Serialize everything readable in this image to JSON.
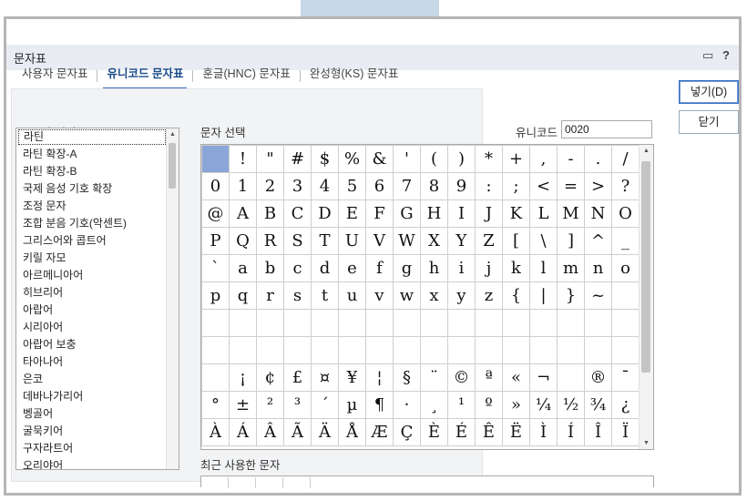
{
  "window": {
    "title": "문자표"
  },
  "tabs": [
    "사용자 문자표",
    "유니코드 문자표",
    "훈글(HNC) 문자표",
    "완성형(KS) 문자표"
  ],
  "active_tab": 1,
  "buttons": {
    "insert": "넣기(D)",
    "close": "닫기"
  },
  "labels": {
    "area": "문자 영역",
    "select": "문자 선택",
    "unicode": "유니코드",
    "recent": "최근 사용한 문자"
  },
  "unicode_value": "0020",
  "areas": [
    "라틴",
    "라틴 확장-A",
    "라틴 확장-B",
    "국제 음성 기호 확장",
    "조정 문자",
    "조합 분음 기호(악센트)",
    "그리스어와 콥트어",
    "키릴 자모",
    "아르메니아어",
    "히브리어",
    "아랍어",
    "시리아어",
    "아랍어 보충",
    "타아나어",
    "은코",
    "데바나가리어",
    "벵골어",
    "굴묵키어",
    "구자라트어",
    "오리야어"
  ],
  "selected_area": 0,
  "chars": [
    [
      " ",
      "!",
      "\"",
      "#",
      "$",
      "%",
      "&",
      "'",
      "(",
      ")",
      "*",
      "+",
      ",",
      "-",
      ".",
      "/"
    ],
    [
      "0",
      "1",
      "2",
      "3",
      "4",
      "5",
      "6",
      "7",
      "8",
      "9",
      ":",
      ";",
      "<",
      "=",
      ">",
      "?"
    ],
    [
      "@",
      "A",
      "B",
      "C",
      "D",
      "E",
      "F",
      "G",
      "H",
      "I",
      "J",
      "K",
      "L",
      "M",
      "N",
      "O"
    ],
    [
      "P",
      "Q",
      "R",
      "S",
      "T",
      "U",
      "V",
      "W",
      "X",
      "Y",
      "Z",
      "[",
      "\\",
      "]",
      "^",
      "_"
    ],
    [
      "`",
      "a",
      "b",
      "c",
      "d",
      "e",
      "f",
      "g",
      "h",
      "i",
      "j",
      "k",
      "l",
      "m",
      "n",
      "o"
    ],
    [
      "p",
      "q",
      "r",
      "s",
      "t",
      "u",
      "v",
      "w",
      "x",
      "y",
      "z",
      "{",
      "|",
      "}",
      "~",
      ""
    ],
    [
      "",
      "",
      "",
      "",
      "",
      "",
      "",
      "",
      "",
      "",
      "",
      "",
      "",
      "",
      "",
      ""
    ],
    [
      "",
      "",
      "",
      "",
      "",
      "",
      "",
      "",
      "",
      "",
      "",
      "",
      "",
      "",
      "",
      ""
    ],
    [
      "",
      "¡",
      "¢",
      "£",
      "¤",
      "¥",
      "¦",
      "§",
      "¨",
      "©",
      "ª",
      "«",
      "¬",
      "",
      "®",
      "¯"
    ],
    [
      "°",
      "±",
      "²",
      "³",
      "´",
      "µ",
      "¶",
      "·",
      "¸",
      "¹",
      "º",
      "»",
      "¼",
      "½",
      "¾",
      "¿"
    ],
    [
      "À",
      "Á",
      "Â",
      "Ã",
      "Ä",
      "Å",
      "Æ",
      "Ç",
      "È",
      "É",
      "Ê",
      "Ë",
      "Ì",
      "Í",
      "Î",
      "Ï"
    ]
  ]
}
